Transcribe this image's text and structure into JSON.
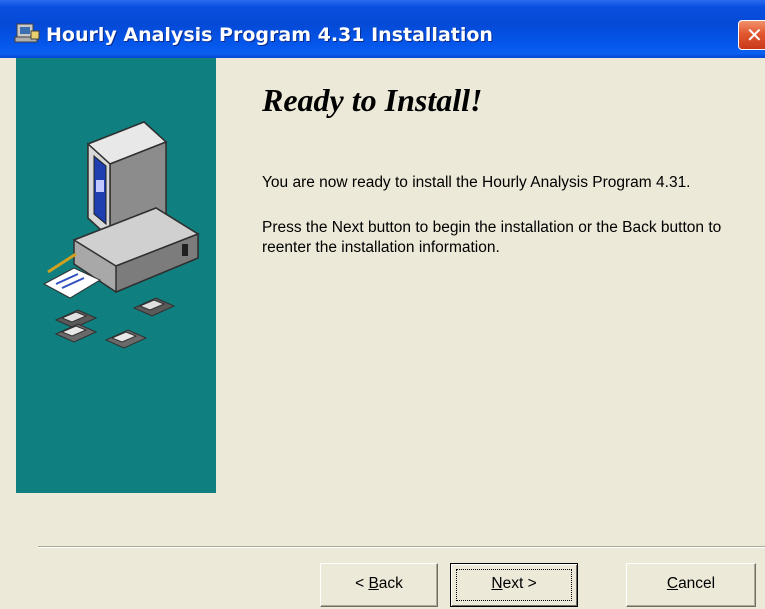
{
  "window": {
    "title": "Hourly Analysis Program 4.31 Installation",
    "title_icon": "installer-icon",
    "close_icon": "close-icon"
  },
  "colors": {
    "titlebar": "#0549d6",
    "sidebar": "#0f7f7f",
    "dialog_bg": "#ece9d8",
    "close_button": "#e2572f"
  },
  "sidebar": {
    "illustration": "computer-with-floppy-disks-illustration"
  },
  "content": {
    "heading": "Ready to Install!",
    "paragraph1": "You are now ready to install the Hourly Analysis Program 4.31.",
    "paragraph2": "Press the Next button to begin the installation or the Back button to reenter the installation information."
  },
  "buttons": {
    "back": {
      "prefix": "< ",
      "mnemonic": "B",
      "rest": "ack"
    },
    "next": {
      "mnemonic": "N",
      "rest": "ext",
      "suffix": " >"
    },
    "cancel": {
      "mnemonic": "C",
      "rest": "ancel"
    }
  }
}
